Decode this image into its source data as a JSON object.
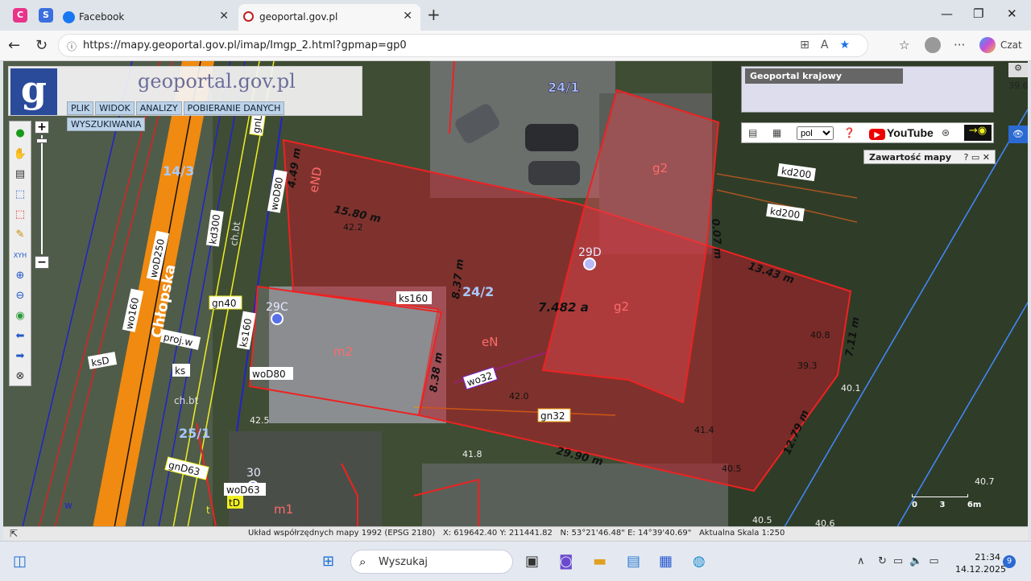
{
  "browser": {
    "pinned_tabs": [
      {
        "letter": "C",
        "color": "#e8348a"
      },
      {
        "letter": "S",
        "color": "#3b6fe0"
      }
    ],
    "tabs": [
      {
        "title": "Facebook",
        "icon_color": "#1877f2"
      },
      {
        "title": "geoportal.gov.pl",
        "icon_color": "#c02020"
      }
    ],
    "url": "https://mapy.geoportal.gov.pl/imap/Imgp_2.html?gpmap=gp0",
    "copilot_label": "Czat"
  },
  "app": {
    "title": "geoportal.gov.pl",
    "logo_letter": "g",
    "menu": [
      "PLIK",
      "WIDOK",
      "ANALIZY",
      "POBIERANIE DANYCH",
      "WYSZUKIWANIA"
    ],
    "overview_label": "Geoportal krajowy",
    "language": "pol",
    "youtube": "YouTube",
    "content_panel": "Zawartość mapy",
    "side_value": "39.6",
    "scale_labels": [
      "0",
      "3",
      "6m"
    ]
  },
  "map": {
    "street": "Chłopska",
    "parcels": [
      {
        "id": "24/1",
        "color": "#a8c8ff"
      },
      {
        "id": "14/3",
        "color": "#a8c8ff"
      },
      {
        "id": "24/2",
        "color": "#a8c8ff"
      },
      {
        "id": "25/1",
        "color": "#a8c8ff"
      }
    ],
    "buildings": [
      "29D",
      "29C",
      "30"
    ],
    "area_label": "7.482 a",
    "dimensions": [
      "4.49 m",
      "15.80 m",
      "8.37 m",
      "8.38 m",
      "0.07 m",
      "13.43 m",
      "7.11 m",
      "12.79 m",
      "29.90 m"
    ],
    "zone_labels": [
      "g2",
      "g2",
      "m2",
      "m1",
      "eN",
      "eND"
    ],
    "utility_labels": [
      "kd200",
      "kd200",
      "ks160",
      "ks160",
      "gn40",
      "gn32",
      "wo32",
      "woD80",
      "woD80",
      "woD250",
      "wo160",
      "woD63",
      "gnD63",
      "ksD",
      "ks",
      "kd300",
      "proj.w",
      "ch.bt",
      "ch.bt",
      "gnL",
      "tD",
      "t",
      "w"
    ],
    "heights": [
      "42.2",
      "42.0",
      "42.5",
      "41.8",
      "41.4",
      "40.5",
      "40.8",
      "39.3",
      "40.1",
      "40.7",
      "40.5",
      "40.6"
    ]
  },
  "status": {
    "coord_system": "Układ współrzędnych mapy 1992 (EPSG 2180)",
    "x": "X: 619642.40",
    "y": "Y: 211441.82",
    "n": "N: 53°21'46.48\"",
    "e": "E: 14°39'40.69\"",
    "scale": "Aktualna Skala 1:250"
  },
  "taskbar": {
    "search_placeholder": "Wyszukaj",
    "time": "21:34",
    "date": "14.12.2025",
    "notifications": "9"
  }
}
